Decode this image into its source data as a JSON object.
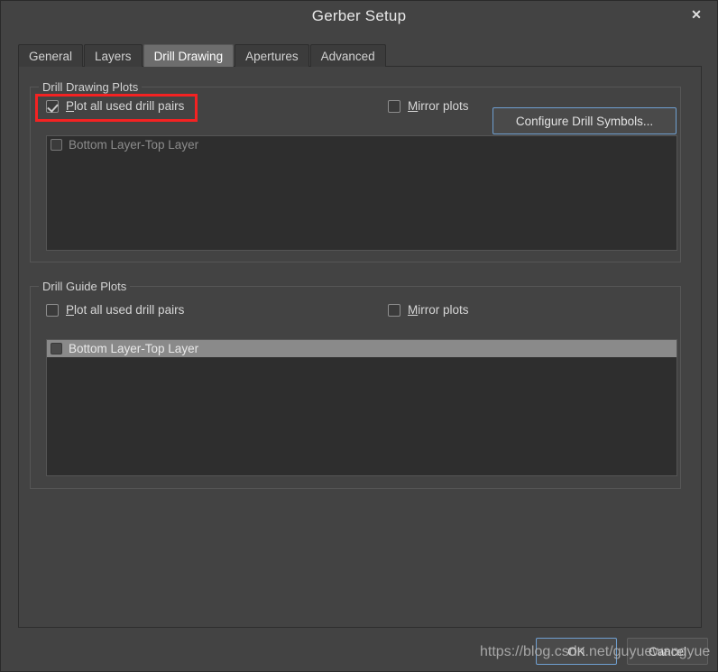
{
  "window": {
    "title": "Gerber Setup",
    "close_label": "✕"
  },
  "tabs": [
    {
      "label": "General",
      "active": false
    },
    {
      "label": "Layers",
      "active": false
    },
    {
      "label": "Drill Drawing",
      "active": true
    },
    {
      "label": "Apertures",
      "active": false
    },
    {
      "label": "Advanced",
      "active": false
    }
  ],
  "drill_drawing_plots": {
    "group_title": "Drill Drawing Plots",
    "plot_all": {
      "mnemonic": "P",
      "label_rest": "lot all used drill pairs",
      "checked": true
    },
    "mirror": {
      "mnemonic": "M",
      "label_rest": "irror plots",
      "checked": false
    },
    "configure_button": "Configure Drill Symbols...",
    "list_items": [
      {
        "label": "Bottom Layer-Top Layer",
        "checked": false,
        "selected": false
      }
    ]
  },
  "drill_guide_plots": {
    "group_title": "Drill Guide Plots",
    "plot_all": {
      "mnemonic": "P",
      "label_rest": "lot all used drill pairs",
      "checked": false
    },
    "mirror": {
      "mnemonic": "M",
      "label_rest": "irror plots",
      "checked": false
    },
    "list_items": [
      {
        "label": "Bottom Layer-Top Layer",
        "checked": false,
        "selected": true
      }
    ]
  },
  "footer": {
    "ok_label": "OK",
    "cancel_label": "Cancel"
  },
  "watermark": {
    "text": "https://blog.csdn.net/guyuewangyue"
  },
  "colors": {
    "dialog_bg": "#434343",
    "listbox_bg": "#2e2e2e",
    "selection": "#8a8a8a",
    "accent_focus": "#6f9fd0",
    "annotation_red": "#f42222",
    "text": "#d6d6d6",
    "text_disabled": "#8c8c8c"
  }
}
